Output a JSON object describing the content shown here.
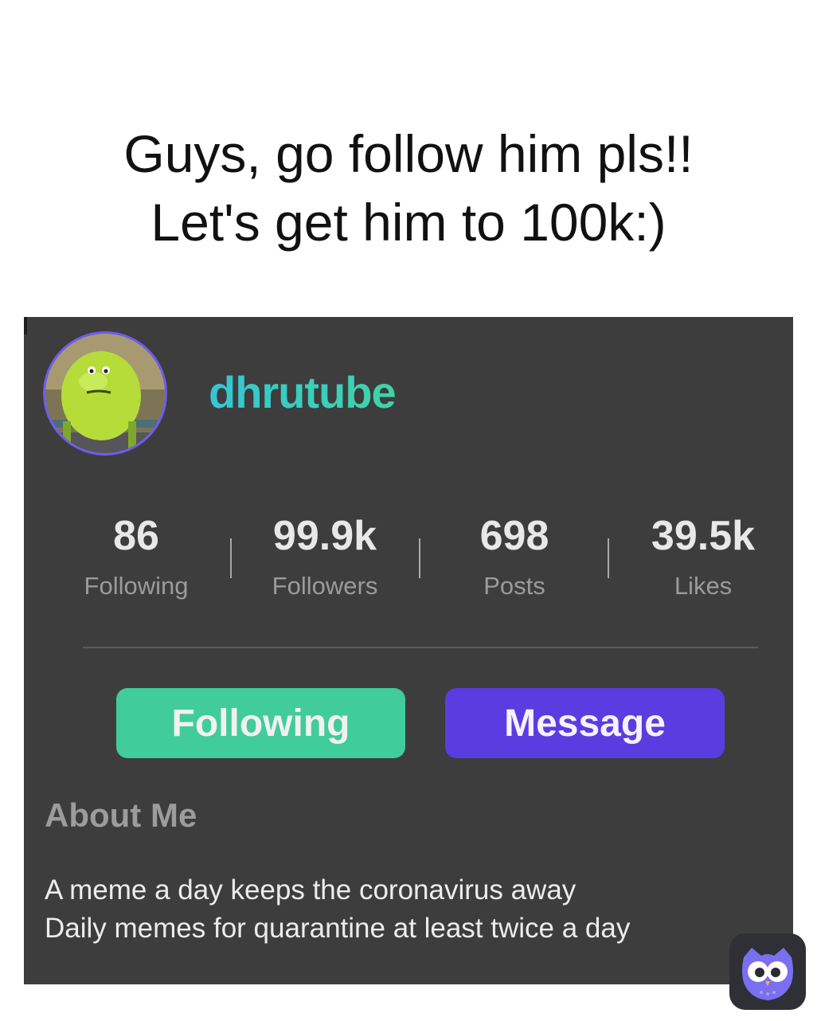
{
  "caption": {
    "line1": "Guys, go follow him pls!!",
    "line2": "Let's get him to 100k:)"
  },
  "profile": {
    "username": "dhrutube",
    "avatar_icon": "green-character-avatar",
    "username_gradient": [
      "#35c6d4",
      "#3fd4a6"
    ]
  },
  "stats": [
    {
      "value": "86",
      "label": "Following"
    },
    {
      "value": "99.9k",
      "label": "Followers"
    },
    {
      "value": "698",
      "label": "Posts"
    },
    {
      "value": "39.5k",
      "label": "Likes"
    }
  ],
  "actions": {
    "following_label": "Following",
    "following_color": "#40cc9b",
    "message_label": "Message",
    "message_color": "#5a3de0"
  },
  "about": {
    "title": "About Me",
    "line1": "A meme a day keeps the coronavirus away",
    "line2": "Daily memes for quarantine at least twice a day"
  },
  "watermark": {
    "icon": "owl-app-icon"
  },
  "colors": {
    "card_background": "#3d3d3d",
    "accent_purple": "#6d5cf0"
  }
}
